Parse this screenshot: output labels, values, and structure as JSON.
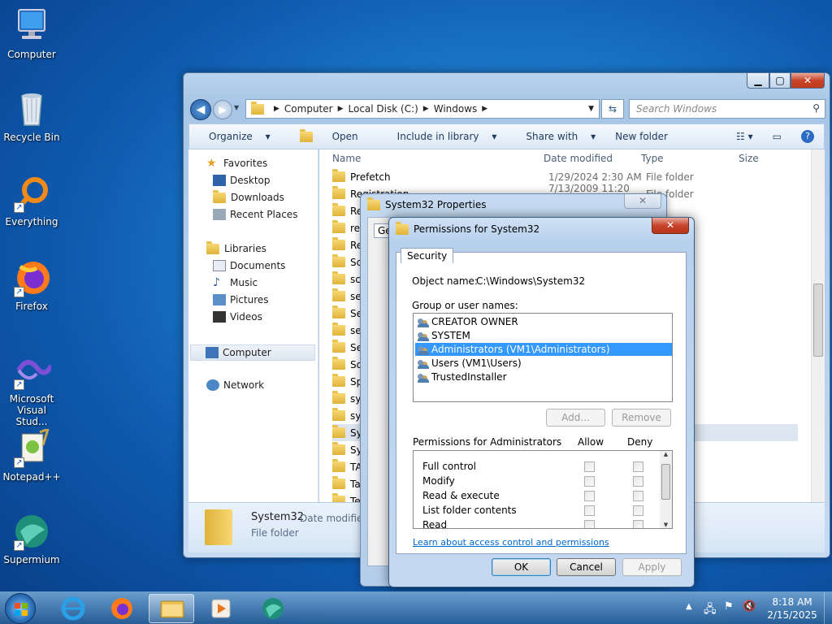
{
  "desktop": {
    "icons": [
      {
        "label": "Computer",
        "icon": "computer-icon"
      },
      {
        "label": "Recycle Bin",
        "icon": "recycle-bin-icon"
      },
      {
        "label": "Everything",
        "icon": "everything-search-icon"
      },
      {
        "label": "Firefox",
        "icon": "firefox-icon"
      },
      {
        "label": "Microsoft Visual Stud...",
        "icon": "visual-studio-icon"
      },
      {
        "label": "Notepad++",
        "icon": "notepadpp-icon"
      },
      {
        "label": "Supermium",
        "icon": "supermium-icon"
      }
    ]
  },
  "explorer": {
    "breadcrumb": [
      "Computer",
      "Local Disk (C:)",
      "Windows"
    ],
    "search_placeholder": "Search Windows",
    "commands": [
      "Organize",
      "Open",
      "Include in library",
      "Share with",
      "New folder"
    ],
    "nav": {
      "favorites": "Favorites",
      "desktop": "Desktop",
      "downloads": "Downloads",
      "recent": "Recent Places",
      "libraries": "Libraries",
      "documents": "Documents",
      "music": "Music",
      "pictures": "Pictures",
      "videos": "Videos",
      "computer": "Computer",
      "network": "Network"
    },
    "columns": {
      "name": "Name",
      "date": "Date modified",
      "type": "Type",
      "size": "Size"
    },
    "rows": [
      {
        "name": "Prefetch",
        "date": "1/29/2024 2:30 AM",
        "type": "File folder"
      },
      {
        "name": "Registration",
        "date": "7/13/2009 11:20 PM",
        "type": "File folder"
      },
      {
        "name": "Re",
        "date": "",
        "type": "lder"
      },
      {
        "name": "res",
        "date": "",
        "type": "lder"
      },
      {
        "name": "Re",
        "date": "",
        "type": ""
      },
      {
        "name": "Sch",
        "date": "",
        "type": ""
      },
      {
        "name": "sch",
        "date": "",
        "type": ""
      },
      {
        "name": "sec",
        "date": "",
        "type": ""
      },
      {
        "name": "Ser",
        "date": "",
        "type": ""
      },
      {
        "name": "ser",
        "date": "",
        "type": ""
      },
      {
        "name": "Set",
        "date": "",
        "type": ""
      },
      {
        "name": "Sof",
        "date": "",
        "type": ""
      },
      {
        "name": "Spe",
        "date": "",
        "type": ""
      },
      {
        "name": "sys",
        "date": "",
        "type": ""
      },
      {
        "name": "sys",
        "date": "",
        "type": ""
      },
      {
        "name": "Sys",
        "date": "",
        "type": ""
      },
      {
        "name": "Sys",
        "date": "",
        "type": ""
      },
      {
        "name": "TA",
        "date": "",
        "type": ""
      },
      {
        "name": "Tas",
        "date": "",
        "type": ""
      },
      {
        "name": "Te",
        "date": "",
        "type": ""
      }
    ],
    "details": {
      "name": "System32",
      "meta": "Date modified",
      "kind": "File folder"
    }
  },
  "props": {
    "title": "System32 Properties",
    "tab_partial": "Ge"
  },
  "perm": {
    "title": "Permissions for System32",
    "tab": "Security",
    "object_label": "Object name:",
    "object_value": "C:\\Windows\\System32",
    "groups_label": "Group or user names:",
    "users": [
      "CREATOR OWNER",
      "SYSTEM",
      "Administrators (VM1\\Administrators)",
      "Users (VM1\\Users)",
      "TrustedInstaller"
    ],
    "add": "Add...",
    "remove": "Remove",
    "perms_label": "Permissions for Administrators",
    "allow": "Allow",
    "deny": "Deny",
    "perms": [
      "Full control",
      "Modify",
      "Read & execute",
      "List folder contents",
      "Read"
    ],
    "link": "Learn about access control and permissions",
    "ok": "OK",
    "cancel": "Cancel",
    "apply": "Apply"
  },
  "taskbar": {
    "time": "8:18 AM",
    "date": "2/15/2025"
  }
}
